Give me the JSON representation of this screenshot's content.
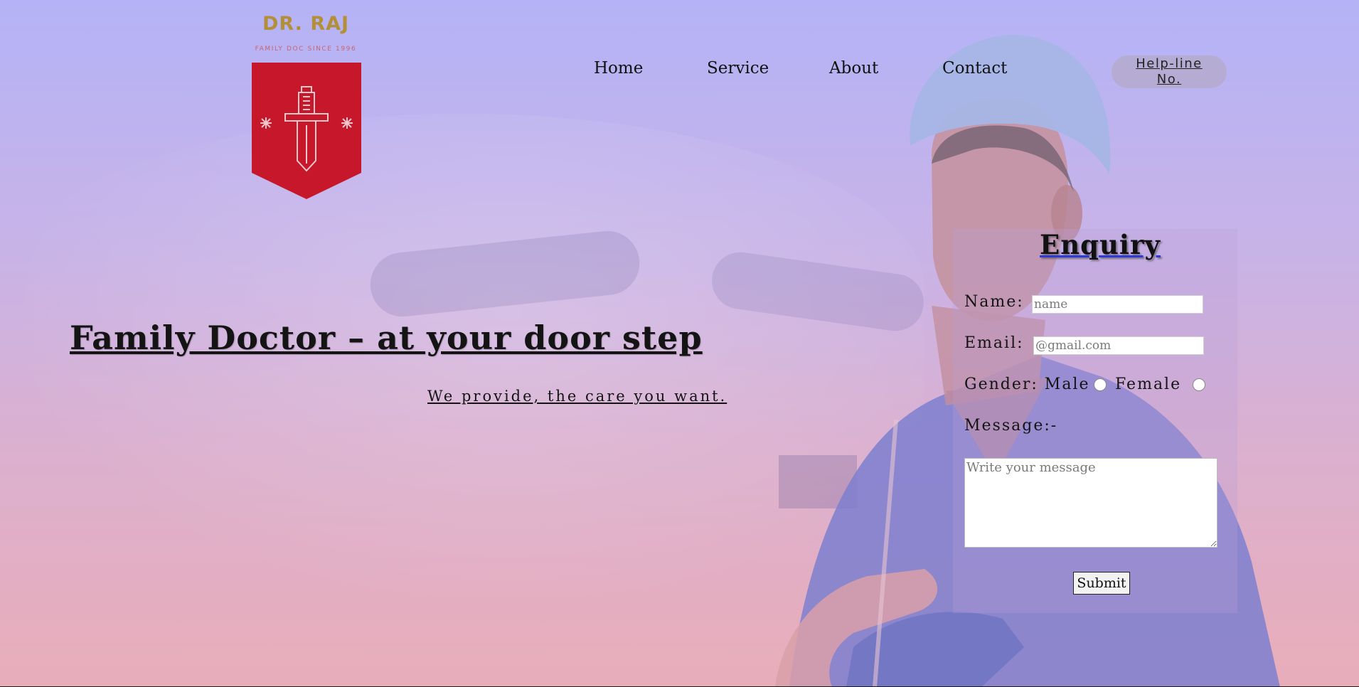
{
  "logo": {
    "name": "DR. RAJ",
    "tagline": "FAMILY DOC SINCE 1996",
    "name_color": "#b38f3a",
    "shield_color": "#c7172a",
    "icon": "sword-shield-icon"
  },
  "nav": {
    "home": "Home",
    "service": "Service",
    "about": "About",
    "contact": "Contact",
    "helpline": "Help-line No."
  },
  "hero": {
    "heading": "Family Doctor – at your door step",
    "subheading": "We provide, the care you want."
  },
  "enquiry": {
    "title": "Enquiry",
    "name_label": "Name:",
    "name_placeholder": "name",
    "email_label": "Email:",
    "email_placeholder": "@gmail.com",
    "gender_label": "Gender: Male",
    "female_label": "Female",
    "message_label": "Message:-",
    "message_placeholder": "Write your message",
    "submit_label": "Submit"
  },
  "colors": {
    "gradient_top": "#b4b3f7",
    "gradient_bottom": "#e9adb9",
    "title_underline": "#2b3bd6"
  }
}
